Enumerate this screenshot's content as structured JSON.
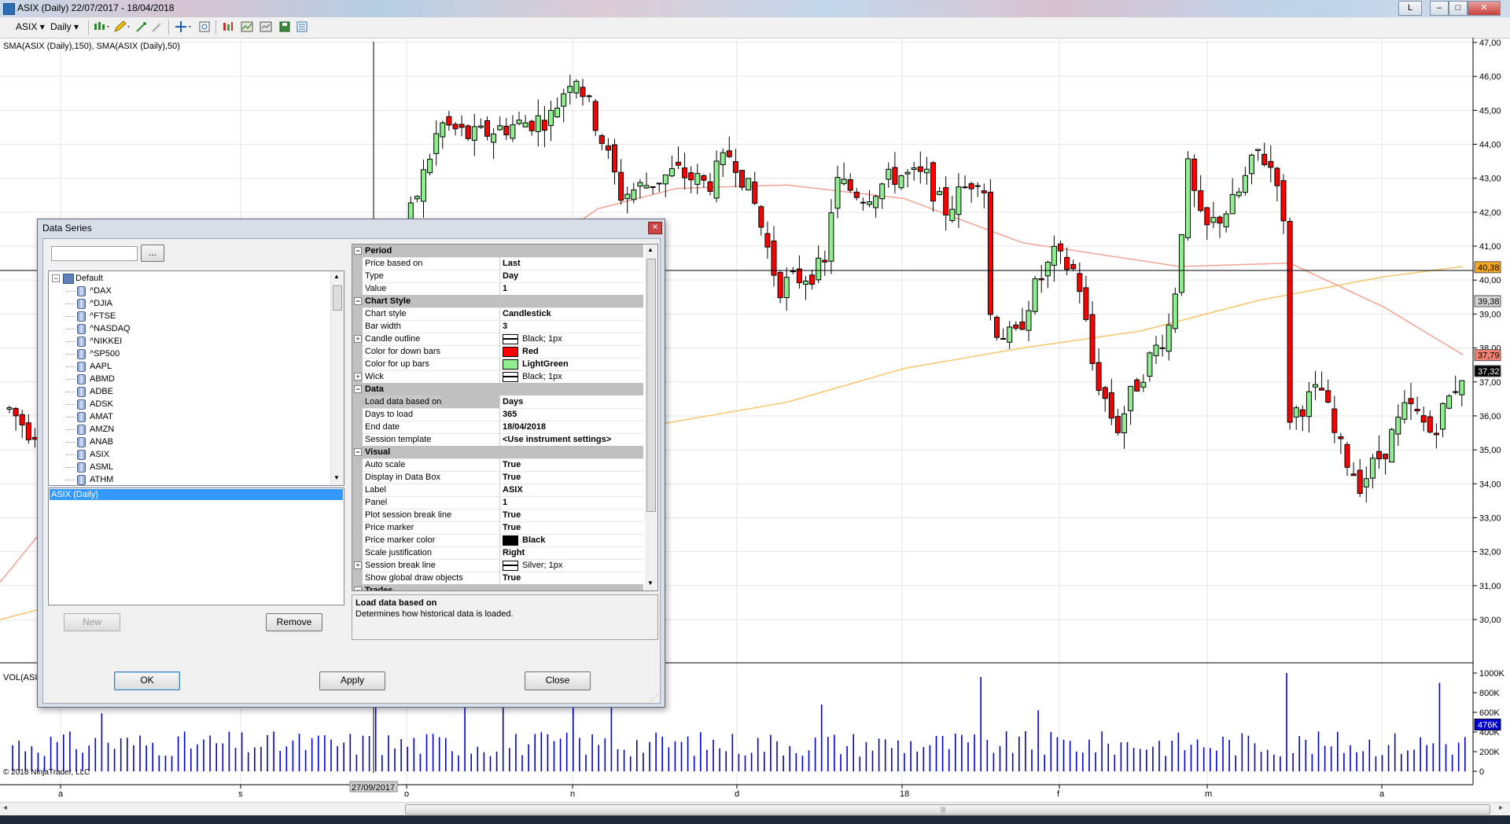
{
  "window": {
    "title": "ASIX (Daily)  22/07/2017 - 18/04/2018",
    "controls": [
      "L",
      "–",
      "□",
      "✕"
    ]
  },
  "toolbar": {
    "instrument": "ASIX",
    "interval": "Daily"
  },
  "chart": {
    "indicator_legend": "SMA(ASIX (Daily),150), SMA(ASIX (Daily),50)",
    "volume_label": "VOL(ASI",
    "copyright": "© 2018 NinjaTrader, LLC",
    "crosshair_date": "27/09/2017",
    "price_axis": [
      "47,00",
      "46,00",
      "45,00",
      "44,00",
      "43,00",
      "42,00",
      "41,00",
      "40,00",
      "39,00",
      "38,00",
      "37,00",
      "36,00",
      "35,00",
      "34,00",
      "33,00",
      "32,00",
      "31,00",
      "30,00"
    ],
    "volume_axis": [
      "1000K",
      "800K",
      "600K",
      "400K",
      "200K",
      "0"
    ],
    "time_axis": [
      "a",
      "s",
      "o",
      "n",
      "d",
      "18",
      "f",
      "m",
      "a"
    ],
    "markers": {
      "sma150": {
        "text": "40,38",
        "color": "#f5a623"
      },
      "crosshair_price": {
        "text": "39,38",
        "color": "#d4d4d4"
      },
      "sma50": {
        "text": "37,79",
        "color": "#f08070"
      },
      "last_price": {
        "text": "37,32",
        "color": "#000000"
      },
      "last_volume": {
        "text": "476K",
        "color": "#0000cc"
      }
    },
    "colors": {
      "up": "#90ee90",
      "down": "#ff0000",
      "volume": "#0000cc",
      "sma50": "#f3a294",
      "sma150": "#f7c56b"
    }
  },
  "dialog": {
    "title": "Data Series",
    "close_icon": "close-icon",
    "browse_label": "...",
    "tree": {
      "root": "Default",
      "items": [
        "^DAX",
        "^DJIA",
        "^FTSE",
        "^NASDAQ",
        "^NIKKEI",
        "^SP500",
        "AAPL",
        "ABMD",
        "ADBE",
        "ADSK",
        "AMAT",
        "AMZN",
        "ANAB",
        "ASIX",
        "ASML",
        "ATHM"
      ]
    },
    "series_list": [
      "ASIX (Daily)"
    ],
    "new_label": "New",
    "remove_label": "Remove",
    "ok_label": "OK",
    "apply_label": "Apply",
    "close_label": "Close",
    "properties": [
      {
        "cat": "Period"
      },
      {
        "name": "Price based on",
        "value": "Last"
      },
      {
        "name": "Type",
        "value": "Day"
      },
      {
        "name": "Value",
        "value": "1"
      },
      {
        "cat": "Chart Style"
      },
      {
        "name": "Chart style",
        "value": "Candlestick"
      },
      {
        "name": "Bar width",
        "value": "3"
      },
      {
        "name": "Candle outline",
        "value": "Black; 1px",
        "swatch": "line",
        "expand": true
      },
      {
        "name": "Color for down bars",
        "value": "Red",
        "swatch": "#ff0000"
      },
      {
        "name": "Color for up bars",
        "value": "LightGreen",
        "swatch": "#90ee90"
      },
      {
        "name": "Wick",
        "value": "Black; 1px",
        "swatch": "line",
        "expand": true
      },
      {
        "cat": "Data"
      },
      {
        "name": "Load data based on",
        "value": "Days",
        "selected": true
      },
      {
        "name": "Days to load",
        "value": "365"
      },
      {
        "name": "End date",
        "value": "18/04/2018"
      },
      {
        "name": "Session template",
        "value": "<Use instrument settings>"
      },
      {
        "cat": "Visual"
      },
      {
        "name": "Auto scale",
        "value": "True"
      },
      {
        "name": "Display in Data Box",
        "value": "True"
      },
      {
        "name": "Label",
        "value": "ASIX"
      },
      {
        "name": "Panel",
        "value": "1"
      },
      {
        "name": "Plot session break line",
        "value": "True"
      },
      {
        "name": "Price marker",
        "value": "True"
      },
      {
        "name": "Price marker color",
        "value": "Black",
        "swatch": "#000000"
      },
      {
        "name": "Scale justification",
        "value": "Right"
      },
      {
        "name": "Session break line",
        "value": "Silver; 1px",
        "swatch": "line",
        "expand": true
      },
      {
        "name": "Show global draw objects",
        "value": "True"
      },
      {
        "cat": "Trades"
      }
    ],
    "help_title": "Load data based on",
    "help_text": "Determines how historical data is loaded."
  }
}
